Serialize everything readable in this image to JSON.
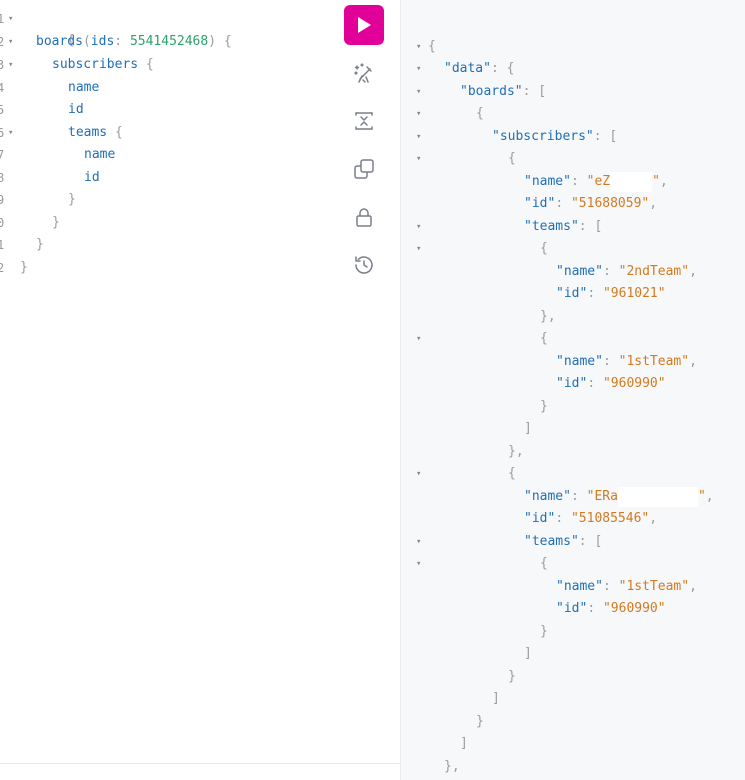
{
  "editor": {
    "line_numbers": [
      "1",
      "2",
      "3",
      "4",
      "5",
      "6",
      "7",
      "8",
      "9",
      "0",
      "1",
      "2"
    ],
    "fold_arrow": "▾",
    "lines": {
      "l1_brace": "{",
      "l2_field": "boards",
      "l2_paren_open": "(",
      "l2_arg": "ids",
      "l2_colon": ": ",
      "l2_value": "5541452468",
      "l2_paren_close": ") {",
      "l3_field": "subscribers",
      "l3_brace": " {",
      "l4_field": "name",
      "l5_field": "id",
      "l6_field": "teams",
      "l6_brace": " {",
      "l7_field": "name",
      "l8_field": "id",
      "l9_brace": "}",
      "l10_brace": "}",
      "l11_brace": "}",
      "l12_brace": "}"
    }
  },
  "toolbar": {
    "run_icon": "play-icon",
    "prettify_icon": "magic-wand-icon",
    "merge_icon": "merge-fragments-icon",
    "copy_icon": "copy-icon",
    "lock_icon": "lock-icon",
    "history_icon": "history-icon",
    "accent_color": "#e10098"
  },
  "result": {
    "fold_arrow": "▾",
    "k_data": "\"data\"",
    "k_boards": "\"boards\"",
    "k_subscribers": "\"subscribers\"",
    "k_name": "\"name\"",
    "k_id": "\"id\"",
    "k_teams": "\"teams\"",
    "sub1_name_start": "\"eZ",
    "sub1_name_end": "\"",
    "sub1_id": "\"51688059\"",
    "team1_name": "\"2ndTeam\"",
    "team1_id": "\"961021\"",
    "team2_name": "\"1stTeam\"",
    "team2_id": "\"960990\"",
    "sub2_name_start": "\"ERa",
    "sub2_name_end": "\"",
    "sub2_id": "\"51085546\"",
    "team3_name": "\"1stTeam\"",
    "team3_id": "\"960990\"",
    "open_brace": "{",
    "close_brace": "}",
    "close_brace_comma": "},",
    "open_bracket": "[",
    "close_bracket": "]",
    "colon": ": ",
    "colon_brace": ": {",
    "colon_bracket": ": [",
    "comma": ","
  }
}
